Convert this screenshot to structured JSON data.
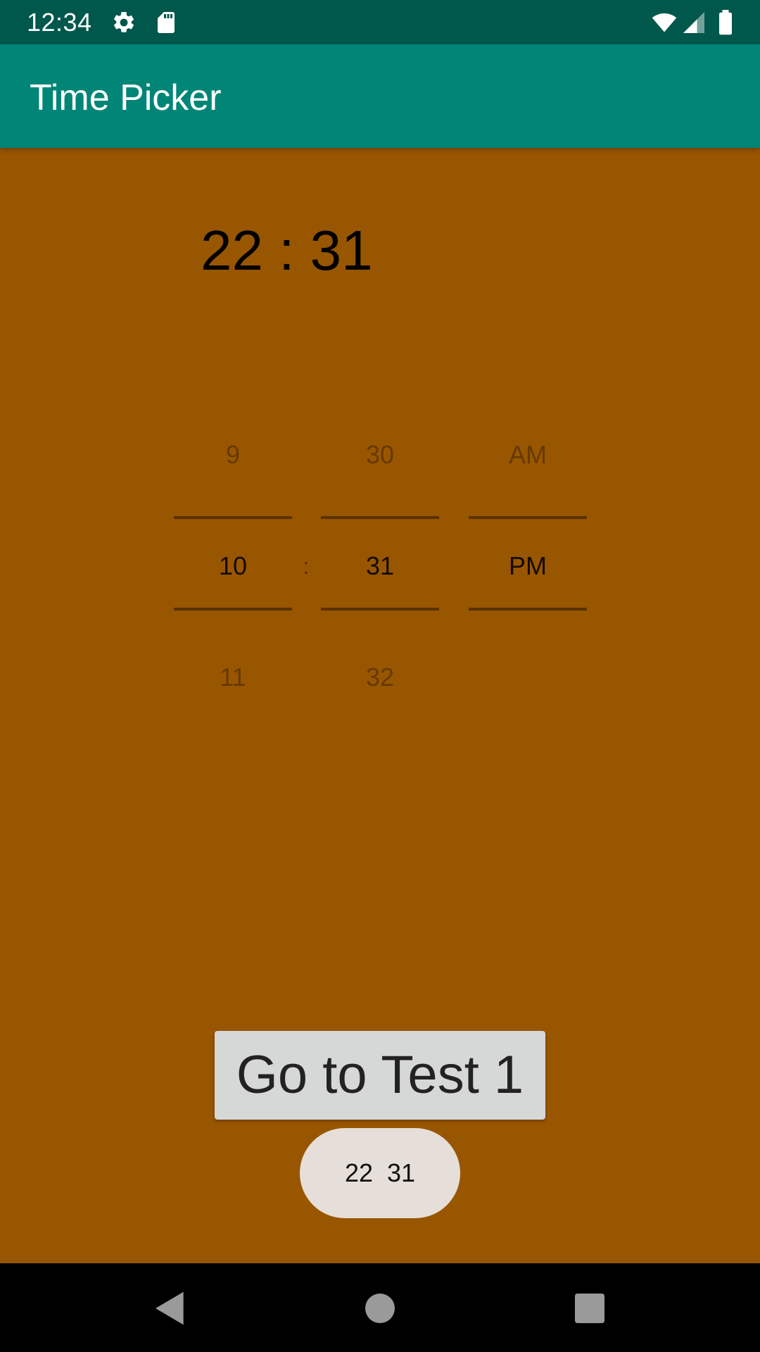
{
  "status_bar": {
    "time": "12:34",
    "icons": [
      "settings-icon",
      "sd-card-icon",
      "wifi-icon",
      "signal-icon",
      "battery-icon"
    ]
  },
  "app_bar": {
    "title": "Time Picker"
  },
  "time_display": {
    "text": "22 : 31"
  },
  "time_picker": {
    "hour": {
      "previous": "9",
      "current": "10",
      "next": "11"
    },
    "separator": ":",
    "minute": {
      "previous": "30",
      "current": "31",
      "next": "32"
    },
    "ampm": {
      "previous": "AM",
      "current": "PM",
      "next": ""
    }
  },
  "button": {
    "label": "Go to Test 1"
  },
  "toast": {
    "text": "22  31"
  },
  "nav_bar": {
    "icons": [
      "back-icon",
      "home-icon",
      "recents-icon"
    ]
  },
  "colors": {
    "status_bar": "#00574B",
    "app_bar": "#008577",
    "background": "#995600",
    "button": "#D6D7D7",
    "toast": "#E6DED8"
  }
}
